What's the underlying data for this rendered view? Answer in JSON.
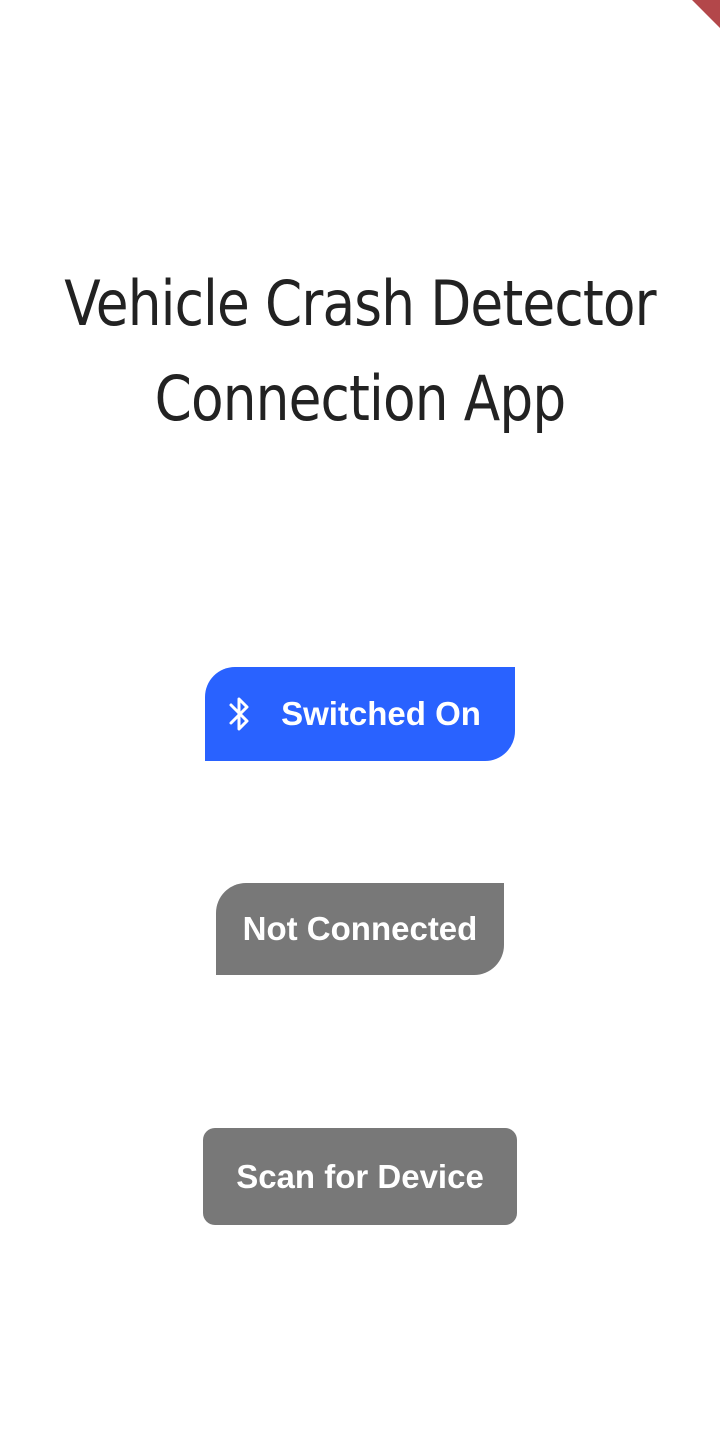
{
  "app": {
    "title_line1": "Vehicle Crash Detector",
    "title_line2": "Connection App"
  },
  "bluetooth_button": {
    "icon": "bluetooth-icon",
    "label": "Switched On",
    "color": "#2962ff"
  },
  "connection_button": {
    "label": "Not Connected",
    "color": "#787878"
  },
  "scan_button": {
    "label": "Scan for Device",
    "color": "#787878"
  },
  "debug_banner_color": "#b3474a"
}
